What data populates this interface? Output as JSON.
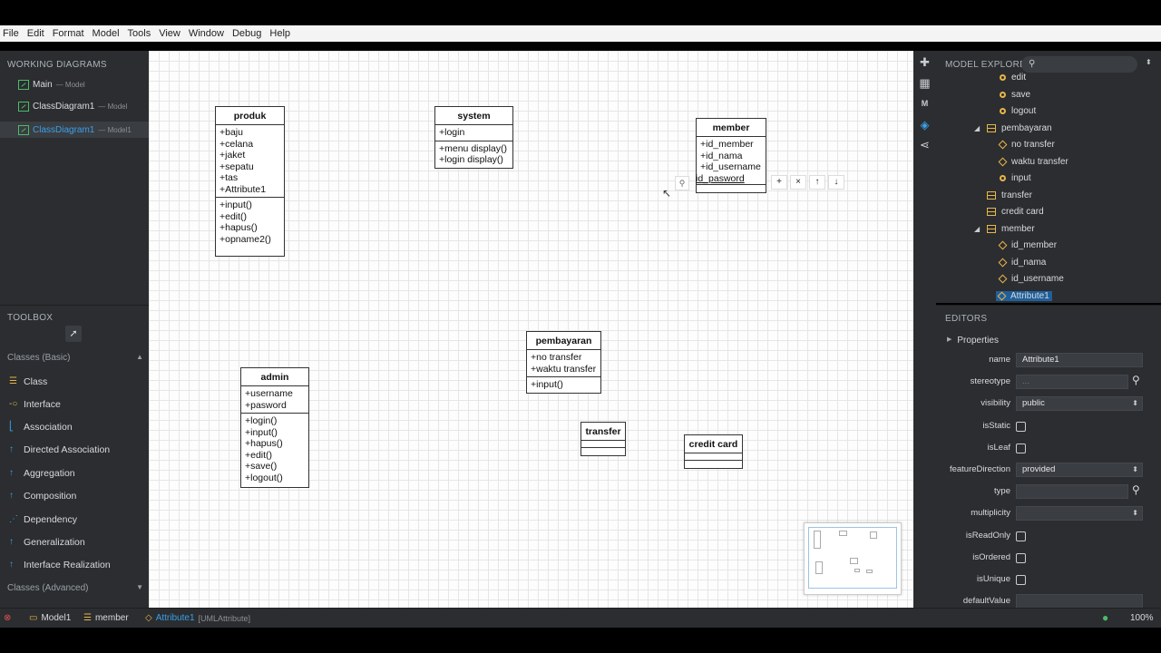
{
  "menu": [
    "File",
    "Edit",
    "Format",
    "Model",
    "Tools",
    "View",
    "Window",
    "Debug",
    "Help"
  ],
  "working_diagrams": {
    "title": "WORKING DIAGRAMS",
    "items": [
      {
        "name": "Main",
        "sub": "— Model"
      },
      {
        "name": "ClassDiagram1",
        "sub": "— Model"
      },
      {
        "name": "ClassDiagram1",
        "sub": "— Model1"
      }
    ]
  },
  "toolbox": {
    "title": "TOOLBOX",
    "group1": "Classes (Basic)",
    "items": [
      "Class",
      "Interface",
      "Association",
      "Directed Association",
      "Aggregation",
      "Composition",
      "Dependency",
      "Generalization",
      "Interface Realization"
    ],
    "group2": "Classes (Advanced)"
  },
  "classes": {
    "produk": {
      "name": "produk",
      "attrs": [
        "+baju",
        "+celana",
        "+jaket",
        "+sepatu",
        "+tas",
        "+Attribute1"
      ],
      "ops": [
        "+input()",
        "+edit()",
        "+hapus()",
        "+opname2()"
      ]
    },
    "system": {
      "name": "system",
      "attrs": [
        "+login"
      ],
      "ops": [
        "+menu display()",
        "+login display()"
      ]
    },
    "member": {
      "name": "member",
      "attrs": [
        "+id_member",
        "+id_nama",
        "+id_username"
      ],
      "editing": "id_pasword"
    },
    "admin": {
      "name": "admin",
      "attrs": [
        "+username",
        "+pasword"
      ],
      "ops": [
        "+login()",
        "+input()",
        "+hapus()",
        "+edit()",
        "+save()",
        "+logout()"
      ]
    },
    "pembayaran": {
      "name": "pembayaran",
      "attrs": [
        "+no transfer",
        "+waktu transfer"
      ],
      "ops": [
        "+input()"
      ]
    },
    "transfer": {
      "name": "transfer"
    },
    "credit_card": {
      "name": "credit card"
    }
  },
  "edit_bar": [
    "+",
    "×",
    "↑",
    "↓"
  ],
  "explorer": {
    "title": "MODEL EXPLORER",
    "rows": [
      {
        "label": "edit",
        "kind": "op",
        "indent": 2
      },
      {
        "label": "save",
        "kind": "op",
        "indent": 2
      },
      {
        "label": "logout",
        "kind": "op",
        "indent": 2
      },
      {
        "label": "pembayaran",
        "kind": "cls",
        "indent": 1,
        "expanded": true
      },
      {
        "label": "no transfer",
        "kind": "attr",
        "indent": 2
      },
      {
        "label": "waktu transfer",
        "kind": "attr",
        "indent": 2
      },
      {
        "label": "input",
        "kind": "op",
        "indent": 2
      },
      {
        "label": "transfer",
        "kind": "cls",
        "indent": 1
      },
      {
        "label": "credit card",
        "kind": "cls",
        "indent": 1
      },
      {
        "label": "member",
        "kind": "cls",
        "indent": 1,
        "expanded": true
      },
      {
        "label": "id_member",
        "kind": "attr",
        "indent": 2
      },
      {
        "label": "id_nama",
        "kind": "attr",
        "indent": 2
      },
      {
        "label": "id_username",
        "kind": "attr",
        "indent": 2
      },
      {
        "label": "Attribute1",
        "kind": "attr",
        "indent": 2,
        "selected": true
      }
    ]
  },
  "editors": {
    "title": "EDITORS",
    "section": "Properties",
    "props": [
      {
        "label": "name",
        "type": "text",
        "value": "Attribute1"
      },
      {
        "label": "stereotype",
        "type": "search",
        "value": "..."
      },
      {
        "label": "visibility",
        "type": "select",
        "value": "public"
      },
      {
        "label": "isStatic",
        "type": "check"
      },
      {
        "label": "isLeaf",
        "type": "check"
      },
      {
        "label": "featureDirection",
        "type": "select",
        "value": "provided"
      },
      {
        "label": "type",
        "type": "search",
        "value": ""
      },
      {
        "label": "multiplicity",
        "type": "select",
        "value": ""
      },
      {
        "label": "isReadOnly",
        "type": "check"
      },
      {
        "label": "isOrdered",
        "type": "check"
      },
      {
        "label": "isUnique",
        "type": "check"
      },
      {
        "label": "defaultValue",
        "type": "text",
        "value": ""
      }
    ]
  },
  "status": {
    "crumbs": [
      "Model1",
      "member",
      "Attribute1"
    ],
    "crumb_type": "[UMLAttribute]",
    "zoom": "100%"
  }
}
